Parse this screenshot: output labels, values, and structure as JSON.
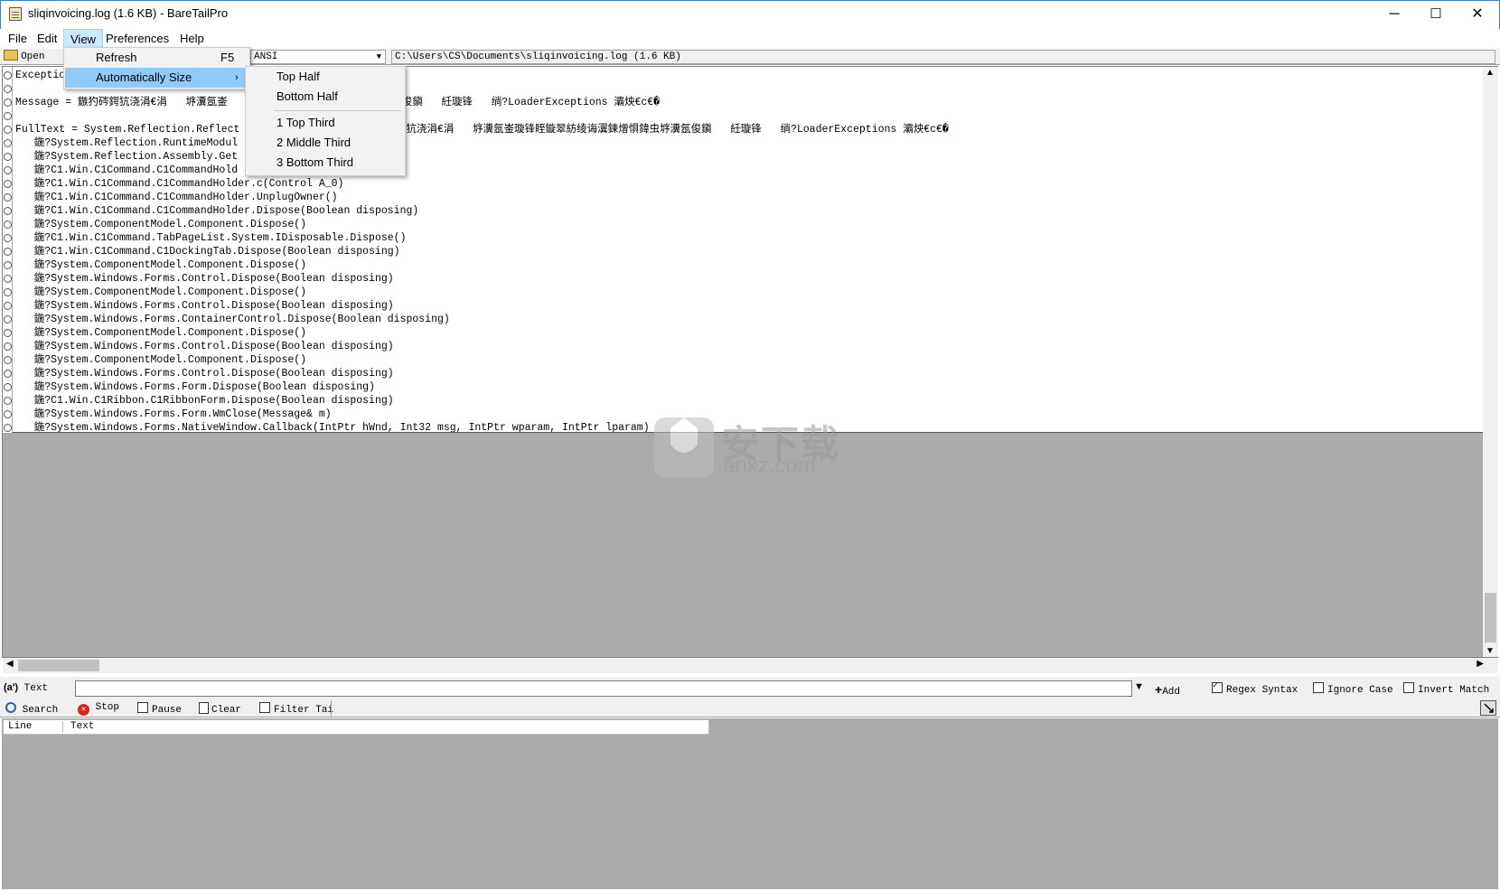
{
  "window": {
    "title": "sliqinvoicing.log (1.6 KB) - BareTailPro",
    "minimize": "─",
    "maximize": "☐",
    "close": "✕"
  },
  "menubar": {
    "file": "File",
    "edit": "Edit",
    "view": "View",
    "preferences": "Preferences",
    "help": "Help"
  },
  "toolbar": {
    "open_label": "Open",
    "encoding": "ANSI",
    "file_path": "C:\\Users\\CS\\Documents\\sliqinvoicing.log (1.6 KB)"
  },
  "view_menu": {
    "refresh": "Refresh",
    "refresh_shortcut": "F5",
    "automatically_size": "Automatically Size"
  },
  "auto_size_submenu": {
    "top_half": "Top Half",
    "bottom_half": "Bottom Half",
    "top_third": "1 Top Third",
    "middle_third": "2 Middle Third",
    "bottom_third": "3 Bottom Third"
  },
  "log_lines": [
    "Exceptio",
    "",
    "Message = 鏃犳硶鍔犺浇涓€涓   垿瀵氬崟                       涔瀵氬俊鎭   紝璇锋   绱?LoaderExceptions 灞炴€с€�",
    "",
    "FullText = System.Reflection.Reflect                         鍔犺浇涓€涓   垿瀵氬崟璇锋眰鏇翠紡绫诲瀷鍊熷惧鍏虫垿瀵氬俊鎭   紝璇锋   绱?LoaderExceptions 灞炴€с€�",
    "   鍦?System.Reflection.RuntimeModul                     odule)",
    "   鍦?System.Reflection.Assembly.Get",
    "   鍦?C1.Win.C1Command.C1CommandHold",
    "   鍦?C1.Win.C1Command.C1CommandHolder.c(Control A_0)",
    "   鍦?C1.Win.C1Command.C1CommandHolder.UnplugOwner()",
    "   鍦?C1.Win.C1Command.C1CommandHolder.Dispose(Boolean disposing)",
    "   鍦?System.ComponentModel.Component.Dispose()",
    "   鍦?C1.Win.C1Command.TabPageList.System.IDisposable.Dispose()",
    "   鍦?C1.Win.C1Command.C1DockingTab.Dispose(Boolean disposing)",
    "   鍦?System.ComponentModel.Component.Dispose()",
    "   鍦?System.Windows.Forms.Control.Dispose(Boolean disposing)",
    "   鍦?System.ComponentModel.Component.Dispose()",
    "   鍦?System.Windows.Forms.Control.Dispose(Boolean disposing)",
    "   鍦?System.Windows.Forms.ContainerControl.Dispose(Boolean disposing)",
    "   鍦?System.ComponentModel.Component.Dispose()",
    "   鍦?System.Windows.Forms.Control.Dispose(Boolean disposing)",
    "   鍦?System.ComponentModel.Component.Dispose()",
    "   鍦?System.Windows.Forms.Control.Dispose(Boolean disposing)",
    "   鍦?System.Windows.Forms.Form.Dispose(Boolean disposing)",
    "   鍦?C1.Win.C1Ribbon.C1RibbonForm.Dispose(Boolean disposing)",
    "   鍦?System.Windows.Forms.Form.WmClose(Message& m)",
    "   鍦?System.Windows.Forms.NativeWindow.Callback(IntPtr hWnd, Int32 msg, IntPtr wparam, IntPtr lparam)"
  ],
  "filter": {
    "text_mode_label": "Text",
    "search_value": "",
    "add_label": "Add",
    "regex_syntax": "Regex Syntax",
    "regex_checked": true,
    "ignore_case": "Ignore Case",
    "ignore_case_checked": false,
    "invert_match": "Invert Match",
    "invert_match_checked": false,
    "search_label": "Search",
    "stop_label": "Stop",
    "pause_label": "Pause",
    "clear_label": "Clear",
    "filter_tail_label": "Filter Tai"
  },
  "results": {
    "col_line": "Line",
    "col_text": "Text"
  },
  "watermark": {
    "text": "安下载",
    "subtext": "anxz.com"
  },
  "colors": {
    "menu_highlight": "#cce8ff",
    "submenu_highlight": "#91c9f7",
    "pane_gray": "#ababab",
    "stop_red": "#d9261c"
  }
}
